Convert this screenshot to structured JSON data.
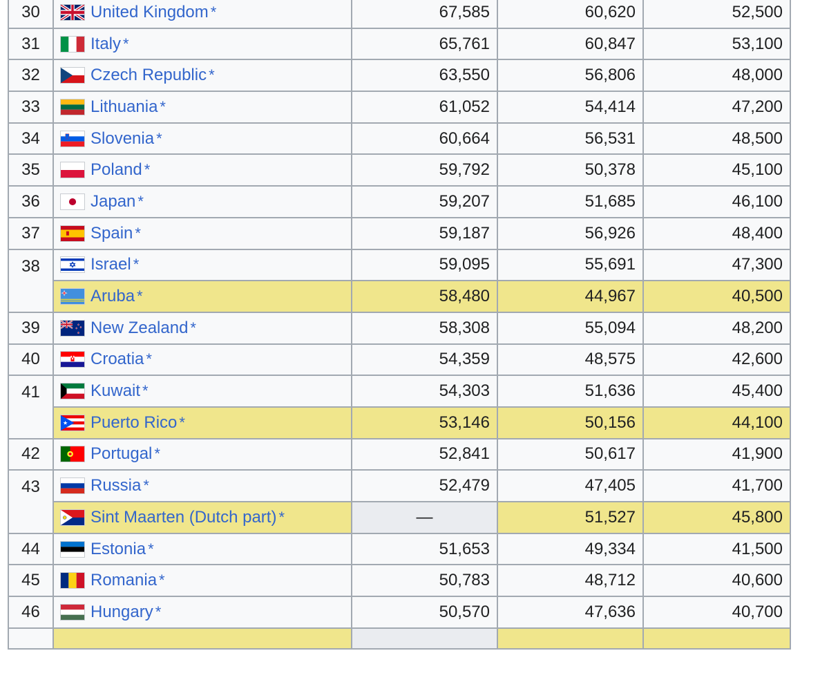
{
  "table": {
    "rows": [
      {
        "rank": "30",
        "country": "United Kingdom",
        "star": "*",
        "flag": "uk-flag-icon",
        "v1": "67,585",
        "v2": "60,620",
        "v3": "52,500",
        "highlight": false
      },
      {
        "rank": "31",
        "country": "Italy",
        "star": "*",
        "flag": "italy-flag-icon",
        "v1": "65,761",
        "v2": "60,847",
        "v3": "53,100",
        "highlight": false
      },
      {
        "rank": "32",
        "country": "Czech Republic",
        "star": "*",
        "flag": "czech-flag-icon",
        "v1": "63,550",
        "v2": "56,806",
        "v3": "48,000",
        "highlight": false
      },
      {
        "rank": "33",
        "country": "Lithuania",
        "star": "*",
        "flag": "lithuania-flag-icon",
        "v1": "61,052",
        "v2": "54,414",
        "v3": "47,200",
        "highlight": false
      },
      {
        "rank": "34",
        "country": "Slovenia",
        "star": "*",
        "flag": "slovenia-flag-icon",
        "v1": "60,664",
        "v2": "56,531",
        "v3": "48,500",
        "highlight": false
      },
      {
        "rank": "35",
        "country": "Poland",
        "star": "*",
        "flag": "poland-flag-icon",
        "v1": "59,792",
        "v2": "50,378",
        "v3": "45,100",
        "highlight": false
      },
      {
        "rank": "36",
        "country": "Japan",
        "star": "*",
        "flag": "japan-flag-icon",
        "v1": "59,207",
        "v2": "51,685",
        "v3": "46,100",
        "highlight": false
      },
      {
        "rank": "37",
        "country": "Spain",
        "star": "*",
        "flag": "spain-flag-icon",
        "v1": "59,187",
        "v2": "56,926",
        "v3": "48,400",
        "highlight": false
      },
      {
        "rank": "38",
        "country": "Israel",
        "star": "*",
        "flag": "israel-flag-icon",
        "v1": "59,095",
        "v2": "55,691",
        "v3": "47,300",
        "highlight": false
      },
      {
        "rank": "",
        "country": "Aruba",
        "star": "*",
        "flag": "aruba-flag-icon",
        "v1": "58,480",
        "v2": "44,967",
        "v3": "40,500",
        "highlight": true
      },
      {
        "rank": "39",
        "country": "New Zealand",
        "star": "*",
        "flag": "new-zealand-flag-icon",
        "v1": "58,308",
        "v2": "55,094",
        "v3": "48,200",
        "highlight": false
      },
      {
        "rank": "40",
        "country": "Croatia",
        "star": "*",
        "flag": "croatia-flag-icon",
        "v1": "54,359",
        "v2": "48,575",
        "v3": "42,600",
        "highlight": false
      },
      {
        "rank": "41",
        "country": "Kuwait",
        "star": "*",
        "flag": "kuwait-flag-icon",
        "v1": "54,303",
        "v2": "51,636",
        "v3": "45,400",
        "highlight": false
      },
      {
        "rank": "",
        "country": "Puerto Rico",
        "star": "*",
        "flag": "puerto-rico-flag-icon",
        "v1": "53,146",
        "v2": "50,156",
        "v3": "44,100",
        "highlight": true
      },
      {
        "rank": "42",
        "country": "Portugal",
        "star": "*",
        "flag": "portugal-flag-icon",
        "v1": "52,841",
        "v2": "50,617",
        "v3": "41,900",
        "highlight": false
      },
      {
        "rank": "43",
        "country": "Russia",
        "star": "*",
        "flag": "russia-flag-icon",
        "v1": "52,479",
        "v2": "47,405",
        "v3": "41,700",
        "highlight": false
      },
      {
        "rank": "",
        "country": "Sint Maarten (Dutch part)",
        "star": "*",
        "flag": "sint-maarten-flag-icon",
        "v1": "—",
        "v2": "51,527",
        "v3": "45,800",
        "highlight": true,
        "v1_na": true
      },
      {
        "rank": "44",
        "country": "Estonia",
        "star": "*",
        "flag": "estonia-flag-icon",
        "v1": "51,653",
        "v2": "49,334",
        "v3": "41,500",
        "highlight": false
      },
      {
        "rank": "45",
        "country": "Romania",
        "star": "*",
        "flag": "romania-flag-icon",
        "v1": "50,783",
        "v2": "48,712",
        "v3": "40,600",
        "highlight": false
      },
      {
        "rank": "46",
        "country": "Hungary",
        "star": "*",
        "flag": "hungary-flag-icon",
        "v1": "50,570",
        "v2": "47,636",
        "v3": "40,700",
        "highlight": false
      }
    ]
  }
}
